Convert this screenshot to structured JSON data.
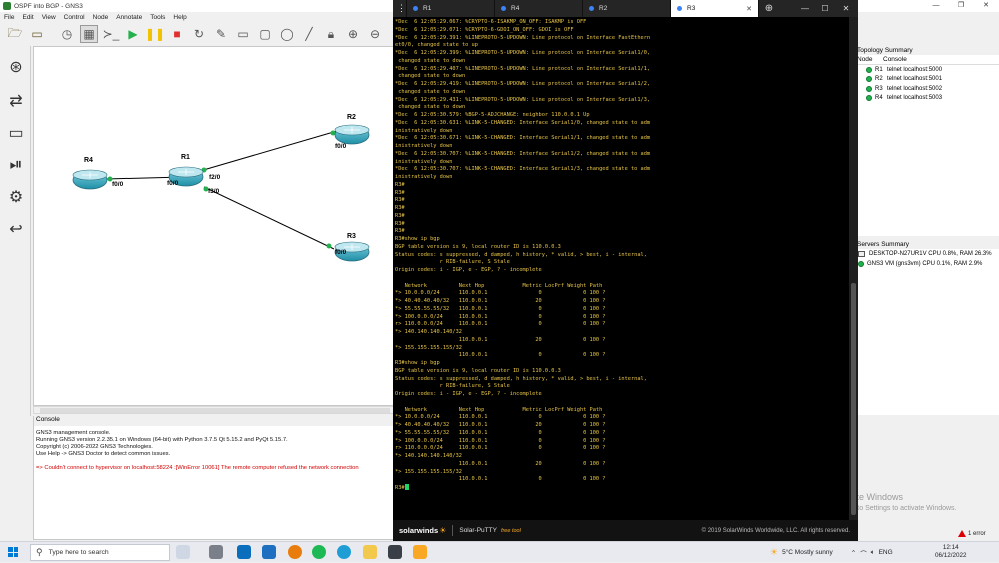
{
  "gns3": {
    "window_title": "OSPF into BGP - GNS3",
    "menu": [
      "File",
      "Edit",
      "View",
      "Control",
      "Node",
      "Annotate",
      "Tools",
      "Help"
    ],
    "routers": [
      {
        "name": "R4",
        "iface": "f0/0"
      },
      {
        "name": "R1",
        "ifaces": [
          "f0/0",
          "f2/0",
          "f3/0"
        ]
      },
      {
        "name": "R2",
        "iface": "f0/0"
      },
      {
        "name": "R3",
        "iface": "f0/0"
      }
    ],
    "console": {
      "title": "Console",
      "lines": [
        "GNS3 management console.",
        "Running GNS3 version 2.2.35.1 on Windows (64-bit) with Python 3.7.5 Qt 5.15.2 and PyQt 5.15.7.",
        "Copyright (c) 2006-2022 GNS3 Technologies.",
        "Use Help -> GNS3 Doctor to detect common issues."
      ],
      "error": "=> Couldn't connect to hypervisor on localhost:58224 :[WinError 10061] The remote computer refused the network connection"
    },
    "topology_summary": {
      "title": "Topology Summary",
      "col_node": "Node",
      "col_console": "Console",
      "rows": [
        {
          "node": "R1",
          "console": "telnet localhost:5000"
        },
        {
          "node": "R2",
          "console": "telnet localhost:5001"
        },
        {
          "node": "R3",
          "console": "telnet localhost:5002"
        },
        {
          "node": "R4",
          "console": "telnet localhost:5003"
        }
      ]
    },
    "servers_summary": {
      "title": "Servers Summary",
      "rows": [
        "DESKTOP-N27UR1V CPU 0.8%, RAM 26.3%",
        "GNS3 VM (gns3vm) CPU 0.1%, RAM 2.9%"
      ]
    },
    "watermark": {
      "title": "Activate Windows",
      "sub": "Go to Settings to activate Windows."
    },
    "error_badge": "1 error"
  },
  "putty": {
    "tabs": [
      "R1",
      "R4",
      "R2",
      "R3"
    ],
    "active_tab": "R3",
    "terminal_lines": [
      "*Dec  6 12:05:29.067: %CRYPTO-6-ISAKMP_ON_OFF: ISAKMP is OFF",
      "*Dec  6 12:05:29.071: %CRYPTO-6-GDOI_ON_OFF: GDOI is OFF",
      "*Dec  6 12:05:29.391: %LINEPROTO-5-UPDOWN: Line protocol on Interface FastEthern",
      "et0/0, changed state to up",
      "*Dec  6 12:05:29.399: %LINEPROTO-5-UPDOWN: Line protocol on Interface Serial1/0,",
      " changed state to down",
      "*Dec  6 12:05:29.407: %LINEPROTO-5-UPDOWN: Line protocol on Interface Serial1/1,",
      " changed state to down",
      "*Dec  6 12:05:29.419: %LINEPROTO-5-UPDOWN: Line protocol on Interface Serial1/2,",
      " changed state to down",
      "*Dec  6 12:05:29.431: %LINEPROTO-5-UPDOWN: Line protocol on Interface Serial1/3,",
      " changed state to down",
      "*Dec  6 12:05:30.579: %BGP-5-ADJCHANGE: neighbor 110.0.0.1 Up",
      "*Dec  6 12:05:30.631: %LINK-5-CHANGED: Interface Serial1/0, changed state to adm",
      "inistratively down",
      "*Dec  6 12:05:30.671: %LINK-5-CHANGED: Interface Serial1/1, changed state to adm",
      "inistratively down",
      "*Dec  6 12:05:30.707: %LINK-5-CHANGED: Interface Serial1/2, changed state to adm",
      "inistratively down",
      "*Dec  6 12:05:30.707: %LINK-5-CHANGED: Interface Serial1/3, changed state to adm",
      "inistratively down",
      "R3#",
      "R3#",
      "R3#",
      "R3#",
      "R3#",
      "R3#",
      "R3#",
      "R3#show ip bgp",
      "BGP table version is 9, local router ID is 110.0.0.3",
      "Status codes: s suppressed, d damped, h history, * valid, > best, i - internal,",
      "              r RIB-failure, S Stale",
      "Origin codes: i - IGP, e - EGP, ? - incomplete",
      "",
      "   Network          Next Hop            Metric LocPrf Weight Path",
      "*> 10.0.0.0/24      110.0.0.1                0             0 100 ?",
      "*> 40.40.40.40/32   110.0.0.1               20             0 100 ?",
      "*> 55.55.55.55/32   110.0.0.1                0             0 100 ?",
      "*> 100.0.0.0/24     110.0.0.1                0             0 100 ?",
      "r> 110.0.0.0/24     110.0.0.1                0             0 100 ?",
      "*> 140.140.140.140/32",
      "                    110.0.0.1               20             0 100 ?",
      "*> 155.155.155.155/32",
      "                    110.0.0.1                0             0 100 ?",
      "R3#show ip bgp",
      "BGP table version is 9, local router ID is 110.0.0.3",
      "Status codes: s suppressed, d damped, h history, * valid, > best, i - internal,",
      "              r RIB-failure, S Stale",
      "Origin codes: i - IGP, e - EGP, ? - incomplete",
      "",
      "   Network          Next Hop            Metric LocPrf Weight Path",
      "*> 10.0.0.0/24      110.0.0.1                0             0 100 ?",
      "*> 40.40.40.40/32   110.0.0.1               20             0 100 ?",
      "*> 55.55.55.55/32   110.0.0.1                0             0 100 ?",
      "*> 100.0.0.0/24     110.0.0.1                0             0 100 ?",
      "r> 110.0.0.0/24     110.0.0.1                0             0 100 ?",
      "*> 140.140.140.140/32",
      "                    110.0.0.1               20             0 100 ?",
      "*> 155.155.155.155/32",
      "                    110.0.0.1                0             0 100 ?",
      ""
    ],
    "prompt": "R3#",
    "footer": {
      "brand": "solarwinds",
      "product": "Solar-PuTTY",
      "free": "free tool",
      "copyright": "© 2019 SolarWinds Worldwide, LLC. All rights reserved."
    }
  },
  "taskbar": {
    "search_placeholder": "Type here to search",
    "weather": "5°C  Mostly sunny",
    "lang": "ENG",
    "time": "12:14",
    "date": "06/12/2022"
  },
  "colors": {
    "term_text": "#e8c547",
    "link_dot": "#22b14c",
    "router": "#1e8fa6",
    "error": "#d00000"
  }
}
